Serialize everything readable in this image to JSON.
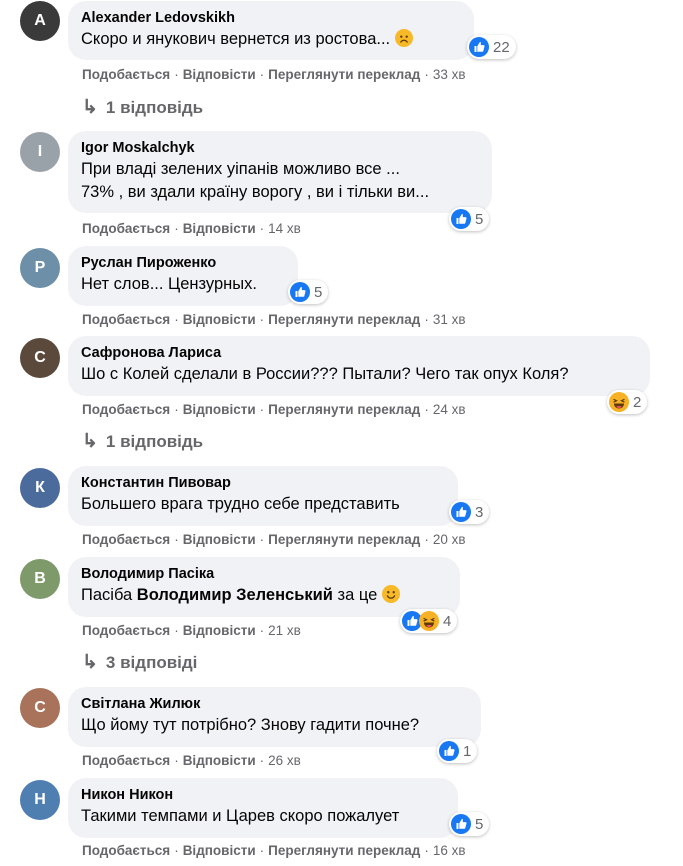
{
  "actions": {
    "like": "Подобається",
    "reply": "Відповісти",
    "translate": "Переглянути переклад",
    "separator": "·"
  },
  "colors": {
    "like_blue": "#1877f2",
    "haha_yellow": "#f7b125",
    "sad_yellow": "#f7b928",
    "muted_text": "#65676b",
    "bubble_bg": "#f0f2f5"
  },
  "comments": [
    {
      "author": "Alexander Ledovskikh",
      "avatar_initial": "A",
      "avatar_color": "#3a3a3a",
      "text": "Скоро и янукович вернется из ростова...",
      "emoji": "😟",
      "reaction_icons": [
        "like-icon"
      ],
      "reaction_count": "22",
      "time": "33 хв",
      "replies_label": "1 відповідь"
    },
    {
      "author": "Igor Moskalchyk",
      "avatar_initial": "I",
      "avatar_color": "#9aa2a9",
      "text_line1": "При владі зелених уіпанів можливо все ...",
      "text_line2": "73% , ви здали країну ворогу , ви і тільки ви...",
      "reaction_icons": [
        "like-icon"
      ],
      "reaction_count": "5",
      "time": "14 хв"
    },
    {
      "author": "Руслан Пироженко",
      "avatar_initial": "Р",
      "avatar_color": "#6d8fa8",
      "text": "Нет слов... Цензурных.",
      "reaction_icons": [
        "like-icon"
      ],
      "reaction_count": "5",
      "time": "31 хв"
    },
    {
      "author": "Сафронова Лариса",
      "avatar_initial": "С",
      "avatar_color": "#5b4a3c",
      "text": "Шо с Колей сделали в России??? Пытали? Чего так опух Коля?",
      "reaction_icons": [
        "haha-icon"
      ],
      "reaction_count": "2",
      "time": "24 хв",
      "replies_label": "1 відповідь"
    },
    {
      "author": "Константин Пивовар",
      "avatar_initial": "К",
      "avatar_color": "#4a6b9c",
      "text": "Большего врага трудно себе представить",
      "reaction_icons": [
        "like-icon"
      ],
      "reaction_count": "3",
      "time": "20 хв"
    },
    {
      "author": "Володимир Пасіка",
      "avatar_initial": "В",
      "avatar_color": "#7f9a6a",
      "text_prefix": "Пасіба",
      "text_bold": "Володимир Зеленський",
      "text_suffix": "за це",
      "emoji": "🙂",
      "reaction_icons": [
        "like-icon",
        "haha-icon"
      ],
      "reaction_count": "4",
      "time": "21 хв",
      "replies_label": "3 відповіді"
    },
    {
      "author": "Світлана Жилюк",
      "avatar_initial": "С",
      "avatar_color": "#a8735a",
      "text": "Що йому тут потрібно? Знову гадити почне?",
      "reaction_icons": [
        "like-icon"
      ],
      "reaction_count": "1",
      "time": "26 хв"
    },
    {
      "author": "Никон Никон",
      "avatar_initial": "Н",
      "avatar_color": "#4f7fb0",
      "text": "Такими темпами и Царев скоро пожалует",
      "reaction_icons": [
        "like-icon"
      ],
      "reaction_count": "5",
      "time": "16 хв"
    }
  ]
}
